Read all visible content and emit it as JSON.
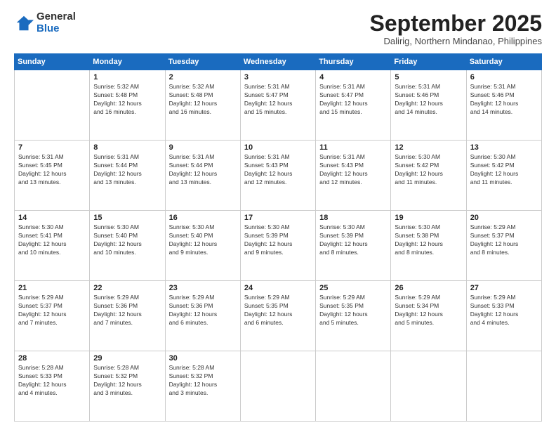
{
  "logo": {
    "general": "General",
    "blue": "Blue"
  },
  "header": {
    "month": "September 2025",
    "location": "Dalirig, Northern Mindanao, Philippines"
  },
  "days_of_week": [
    "Sunday",
    "Monday",
    "Tuesday",
    "Wednesday",
    "Thursday",
    "Friday",
    "Saturday"
  ],
  "weeks": [
    [
      {
        "day": "",
        "info": ""
      },
      {
        "day": "1",
        "info": "Sunrise: 5:32 AM\nSunset: 5:48 PM\nDaylight: 12 hours\nand 16 minutes."
      },
      {
        "day": "2",
        "info": "Sunrise: 5:32 AM\nSunset: 5:48 PM\nDaylight: 12 hours\nand 16 minutes."
      },
      {
        "day": "3",
        "info": "Sunrise: 5:31 AM\nSunset: 5:47 PM\nDaylight: 12 hours\nand 15 minutes."
      },
      {
        "day": "4",
        "info": "Sunrise: 5:31 AM\nSunset: 5:47 PM\nDaylight: 12 hours\nand 15 minutes."
      },
      {
        "day": "5",
        "info": "Sunrise: 5:31 AM\nSunset: 5:46 PM\nDaylight: 12 hours\nand 14 minutes."
      },
      {
        "day": "6",
        "info": "Sunrise: 5:31 AM\nSunset: 5:46 PM\nDaylight: 12 hours\nand 14 minutes."
      }
    ],
    [
      {
        "day": "7",
        "info": "Sunrise: 5:31 AM\nSunset: 5:45 PM\nDaylight: 12 hours\nand 13 minutes."
      },
      {
        "day": "8",
        "info": "Sunrise: 5:31 AM\nSunset: 5:44 PM\nDaylight: 12 hours\nand 13 minutes."
      },
      {
        "day": "9",
        "info": "Sunrise: 5:31 AM\nSunset: 5:44 PM\nDaylight: 12 hours\nand 13 minutes."
      },
      {
        "day": "10",
        "info": "Sunrise: 5:31 AM\nSunset: 5:43 PM\nDaylight: 12 hours\nand 12 minutes."
      },
      {
        "day": "11",
        "info": "Sunrise: 5:31 AM\nSunset: 5:43 PM\nDaylight: 12 hours\nand 12 minutes."
      },
      {
        "day": "12",
        "info": "Sunrise: 5:30 AM\nSunset: 5:42 PM\nDaylight: 12 hours\nand 11 minutes."
      },
      {
        "day": "13",
        "info": "Sunrise: 5:30 AM\nSunset: 5:42 PM\nDaylight: 12 hours\nand 11 minutes."
      }
    ],
    [
      {
        "day": "14",
        "info": "Sunrise: 5:30 AM\nSunset: 5:41 PM\nDaylight: 12 hours\nand 10 minutes."
      },
      {
        "day": "15",
        "info": "Sunrise: 5:30 AM\nSunset: 5:40 PM\nDaylight: 12 hours\nand 10 minutes."
      },
      {
        "day": "16",
        "info": "Sunrise: 5:30 AM\nSunset: 5:40 PM\nDaylight: 12 hours\nand 9 minutes."
      },
      {
        "day": "17",
        "info": "Sunrise: 5:30 AM\nSunset: 5:39 PM\nDaylight: 12 hours\nand 9 minutes."
      },
      {
        "day": "18",
        "info": "Sunrise: 5:30 AM\nSunset: 5:39 PM\nDaylight: 12 hours\nand 8 minutes."
      },
      {
        "day": "19",
        "info": "Sunrise: 5:30 AM\nSunset: 5:38 PM\nDaylight: 12 hours\nand 8 minutes."
      },
      {
        "day": "20",
        "info": "Sunrise: 5:29 AM\nSunset: 5:37 PM\nDaylight: 12 hours\nand 8 minutes."
      }
    ],
    [
      {
        "day": "21",
        "info": "Sunrise: 5:29 AM\nSunset: 5:37 PM\nDaylight: 12 hours\nand 7 minutes."
      },
      {
        "day": "22",
        "info": "Sunrise: 5:29 AM\nSunset: 5:36 PM\nDaylight: 12 hours\nand 7 minutes."
      },
      {
        "day": "23",
        "info": "Sunrise: 5:29 AM\nSunset: 5:36 PM\nDaylight: 12 hours\nand 6 minutes."
      },
      {
        "day": "24",
        "info": "Sunrise: 5:29 AM\nSunset: 5:35 PM\nDaylight: 12 hours\nand 6 minutes."
      },
      {
        "day": "25",
        "info": "Sunrise: 5:29 AM\nSunset: 5:35 PM\nDaylight: 12 hours\nand 5 minutes."
      },
      {
        "day": "26",
        "info": "Sunrise: 5:29 AM\nSunset: 5:34 PM\nDaylight: 12 hours\nand 5 minutes."
      },
      {
        "day": "27",
        "info": "Sunrise: 5:29 AM\nSunset: 5:33 PM\nDaylight: 12 hours\nand 4 minutes."
      }
    ],
    [
      {
        "day": "28",
        "info": "Sunrise: 5:28 AM\nSunset: 5:33 PM\nDaylight: 12 hours\nand 4 minutes."
      },
      {
        "day": "29",
        "info": "Sunrise: 5:28 AM\nSunset: 5:32 PM\nDaylight: 12 hours\nand 3 minutes."
      },
      {
        "day": "30",
        "info": "Sunrise: 5:28 AM\nSunset: 5:32 PM\nDaylight: 12 hours\nand 3 minutes."
      },
      {
        "day": "",
        "info": ""
      },
      {
        "day": "",
        "info": ""
      },
      {
        "day": "",
        "info": ""
      },
      {
        "day": "",
        "info": ""
      }
    ]
  ]
}
